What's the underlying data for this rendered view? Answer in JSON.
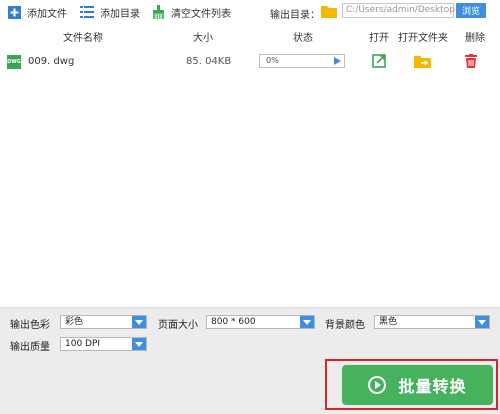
{
  "toolbar": {
    "add_file": "添加文件",
    "add_folder": "添加目录",
    "clear_list": "清空文件列表",
    "output_dir_label": "输出目录：",
    "output_path": "C:/Users/admin/Desktop",
    "browse": "浏览"
  },
  "table": {
    "headers": {
      "name": "文件名称",
      "size": "大小",
      "status": "状态",
      "open": "打开",
      "open_folder": "打开文件夹",
      "delete": "删除"
    },
    "rows": [
      {
        "badge": "DWG",
        "name": "009. dwg",
        "size": "85. 04KB",
        "progress_text": "0%",
        "progress_fraction": 0
      }
    ]
  },
  "options": {
    "color_label": "输出色彩",
    "color_value": "彩色",
    "page_size_label": "页面大小",
    "page_size_value": "800 * 600",
    "bg_color_label": "背景颜色",
    "bg_color_value": "黑色",
    "quality_label": "输出质量",
    "quality_value": "100 DPI"
  },
  "footer": {
    "convert_button": "批量转换"
  },
  "colors": {
    "accent_blue": "#3f8fe0",
    "green": "#46b25e",
    "highlight_red": "#d9262c"
  }
}
